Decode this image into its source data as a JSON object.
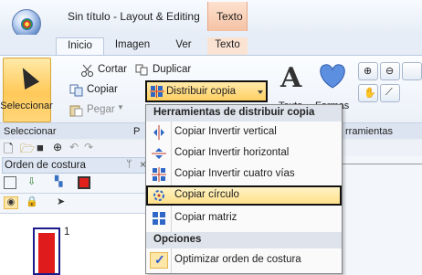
{
  "window": {
    "title": "Sin título - Layout & Editing",
    "context_tab": "Texto"
  },
  "tabs": [
    "Inicio",
    "Imagen",
    "Ver",
    "Texto"
  ],
  "ribbon": {
    "seleccionar": "Seleccionar",
    "cortar": "Cortar",
    "copiar": "Copiar",
    "pegar": "Pegar",
    "duplicar": "Duplicar",
    "distribuir_copia": "Distribuir copia",
    "texto": "Texto",
    "formas": "Formas",
    "groups": {
      "seleccionar": "Seleccionar",
      "portapapeles": "P",
      "herramientas": "rramientas"
    }
  },
  "panel": {
    "title": "Orden de costura",
    "pin": "−",
    "close": "×",
    "stitch_number": "1"
  },
  "menu": {
    "header_tools": "Herramientas de distribuir copia",
    "items": [
      "Copiar Invertir vertical",
      "Copiar Invertir horizontal",
      "Copiar Invertir cuatro vías",
      "Copiar círculo",
      "Copiar matriz"
    ],
    "header_options": "Opciones",
    "option_item": "Optimizar orden de costura",
    "highlighted_index": 3
  },
  "colors": {
    "selection": "#ffcf62",
    "context_tab": "#f5c2a4",
    "accent_blue": "#2f67c7"
  }
}
